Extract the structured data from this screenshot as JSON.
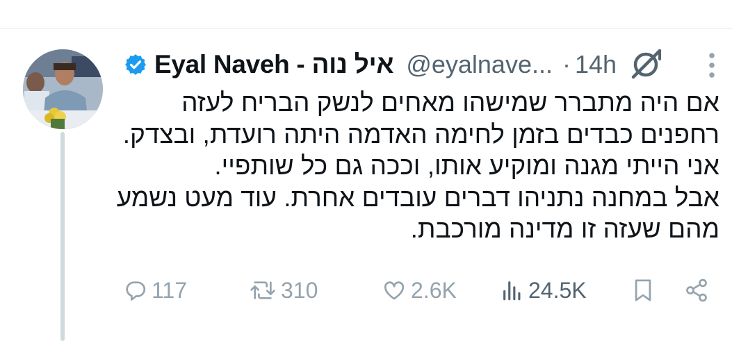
{
  "tweet": {
    "display_name": "Eyal Naveh - איל נוה",
    "handle": "@eyalnave...",
    "separator": "·",
    "time": "14h",
    "text_lines": [
      "אם היה מתברר שמישהו מאחים לנשק הבריח לעזה",
      "רחפנים כבדים בזמן לחימה האדמה היתה רועדת, ובצדק.",
      "אני הייתי מגנה ומוקיע אותו, וככה גם כל שותפיי.",
      "אבל במחנה נתניהו דברים עובדים אחרת. עוד מעט נשמע",
      "מהם שעזה זו מדינה מורכבת."
    ]
  },
  "icons": {
    "verified": "verified-badge-icon",
    "grok": "grok-icon",
    "more": "more-options-icon",
    "reply": "reply-icon",
    "retweet": "retweet-icon",
    "like": "heart-icon",
    "views": "views-icon",
    "bookmark": "bookmark-icon",
    "share": "share-icon"
  },
  "actions": {
    "replies": "117",
    "retweets": "310",
    "likes": "2.6K",
    "views": "24.5K"
  },
  "colors": {
    "verified": "#1d9bf0",
    "text": "#0f1419",
    "secondary": "#536471",
    "action_icon": "#94a3ad",
    "divider": "#dfe7ec"
  }
}
